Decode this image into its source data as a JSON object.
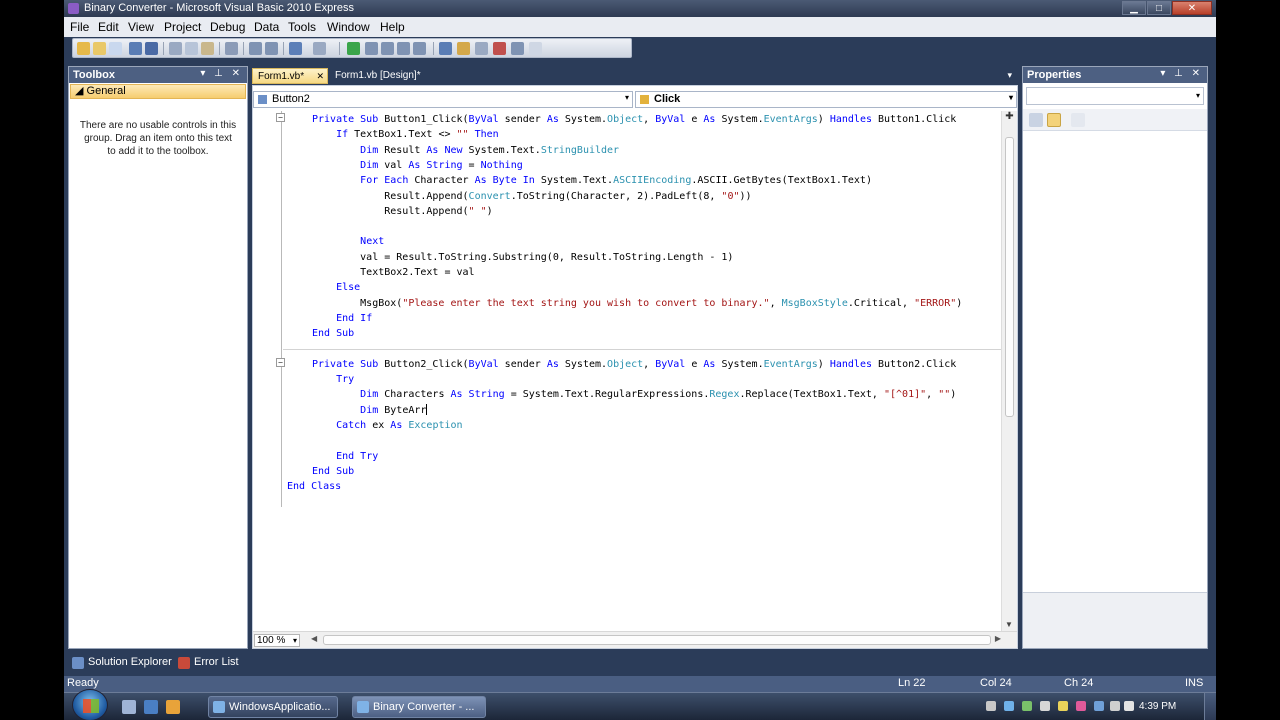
{
  "window": {
    "title": "Binary Converter - Microsoft Visual Basic 2010 Express"
  },
  "menu": [
    "File",
    "Edit",
    "View",
    "Project",
    "Debug",
    "Data",
    "Tools",
    "Window",
    "Help"
  ],
  "toolbox": {
    "title": "Toolbox",
    "group": "General",
    "empty_text": "There are no usable controls in this group. Drag an item onto this text to add it to the toolbox."
  },
  "doc_tabs": {
    "active": "Form1.vb*",
    "inactive": "Form1.vb [Design]*"
  },
  "editor": {
    "object_combo": "Button2",
    "event_combo": "Click",
    "zoom": "100 %"
  },
  "code_lines": [
    [
      [
        "kw",
        "Private Sub "
      ],
      [
        "",
        "Button1_Click("
      ],
      [
        "kw",
        "ByVal"
      ],
      [
        "",
        " sender "
      ],
      [
        "kw",
        "As"
      ],
      [
        "",
        " System."
      ],
      [
        "ty",
        "Object"
      ],
      [
        "",
        ", "
      ],
      [
        "kw",
        "ByVal"
      ],
      [
        "",
        " e "
      ],
      [
        "kw",
        "As"
      ],
      [
        "",
        " System."
      ],
      [
        "ty",
        "EventArgs"
      ],
      [
        "",
        ") "
      ],
      [
        "kw",
        "Handles"
      ],
      [
        "",
        " Button1.Click"
      ]
    ],
    [
      [
        "",
        "    "
      ],
      [
        "kw",
        "If"
      ],
      [
        "",
        " TextBox1.Text <> "
      ],
      [
        "st",
        "\"\""
      ],
      [
        "kw",
        " Then"
      ]
    ],
    [
      [
        "",
        "        "
      ],
      [
        "kw",
        "Dim"
      ],
      [
        "",
        " Result "
      ],
      [
        "kw",
        "As New"
      ],
      [
        "",
        " System.Text."
      ],
      [
        "ty",
        "StringBuilder"
      ]
    ],
    [
      [
        "",
        "        "
      ],
      [
        "kw",
        "Dim"
      ],
      [
        "",
        " val "
      ],
      [
        "kw",
        "As String"
      ],
      [
        "",
        " = "
      ],
      [
        "kw",
        "Nothing"
      ]
    ],
    [
      [
        "",
        "        "
      ],
      [
        "kw",
        "For Each"
      ],
      [
        "",
        " Character "
      ],
      [
        "kw",
        "As Byte In"
      ],
      [
        "",
        " System.Text."
      ],
      [
        "ty",
        "ASCIIEncoding"
      ],
      [
        "",
        ".ASCII.GetBytes(TextBox1.Text)"
      ]
    ],
    [
      [
        "",
        "            Result.Append("
      ],
      [
        "ty",
        "Convert"
      ],
      [
        "",
        ".ToString(Character, 2).PadLeft(8, "
      ],
      [
        "st",
        "\"0\""
      ],
      [
        "",
        "))"
      ]
    ],
    [
      [
        "",
        "            Result.Append("
      ],
      [
        "st",
        "\" \""
      ],
      [
        "",
        ")"
      ]
    ],
    [
      [
        "",
        ""
      ]
    ],
    [
      [
        "",
        "        "
      ],
      [
        "kw",
        "Next"
      ]
    ],
    [
      [
        "",
        "        val = Result.ToString.Substring(0, Result.ToString.Length - 1)"
      ]
    ],
    [
      [
        "",
        "        TextBox2.Text = val"
      ]
    ],
    [
      [
        "",
        "    "
      ],
      [
        "kw",
        "Else"
      ]
    ],
    [
      [
        "",
        "        MsgBox("
      ],
      [
        "st",
        "\"Please enter the text string you wish to convert to binary.\""
      ],
      [
        "",
        ", "
      ],
      [
        "ty",
        "MsgBoxStyle"
      ],
      [
        "",
        ".Critical, "
      ],
      [
        "st",
        "\"ERROR\""
      ],
      [
        "",
        ")"
      ]
    ],
    [
      [
        "",
        "    "
      ],
      [
        "kw",
        "End If"
      ]
    ],
    [
      [
        "kw",
        "End Sub"
      ]
    ],
    [
      [
        "",
        ""
      ]
    ],
    [
      [
        "kw",
        "Private Sub "
      ],
      [
        "",
        "Button2_Click("
      ],
      [
        "kw",
        "ByVal"
      ],
      [
        "",
        " sender "
      ],
      [
        "kw",
        "As"
      ],
      [
        "",
        " System."
      ],
      [
        "ty",
        "Object"
      ],
      [
        "",
        ", "
      ],
      [
        "kw",
        "ByVal"
      ],
      [
        "",
        " e "
      ],
      [
        "kw",
        "As"
      ],
      [
        "",
        " System."
      ],
      [
        "ty",
        "EventArgs"
      ],
      [
        "",
        ") "
      ],
      [
        "kw",
        "Handles"
      ],
      [
        "",
        " Button2.Click"
      ]
    ],
    [
      [
        "",
        "    "
      ],
      [
        "kw",
        "Try"
      ]
    ],
    [
      [
        "",
        "        "
      ],
      [
        "kw",
        "Dim"
      ],
      [
        "",
        " Characters "
      ],
      [
        "kw",
        "As String"
      ],
      [
        "",
        " = System.Text.RegularExpressions."
      ],
      [
        "ty",
        "Regex"
      ],
      [
        "",
        ".Replace(TextBox1.Text, "
      ],
      [
        "st",
        "\"[^01]\""
      ],
      [
        "",
        ", "
      ],
      [
        "st",
        "\"\""
      ],
      [
        "",
        ")"
      ]
    ],
    [
      [
        "",
        "        "
      ],
      [
        "kw",
        "Dim"
      ],
      [
        "",
        " ByteArr"
      ]
    ],
    [
      [
        "",
        "    "
      ],
      [
        "kw",
        "Catch"
      ],
      [
        "",
        " ex "
      ],
      [
        "kw",
        "As"
      ],
      [
        " ",
        " "
      ],
      [
        "ty",
        "Exception"
      ]
    ],
    [
      [
        "",
        ""
      ]
    ],
    [
      [
        "",
        "    "
      ],
      [
        "kw",
        "End Try"
      ]
    ],
    [
      [
        "kw",
        "End Sub"
      ]
    ],
    [
      [
        "kw",
        "End Class"
      ]
    ]
  ],
  "properties": {
    "title": "Properties"
  },
  "bottom_tabs": [
    "Solution Explorer",
    "Error List"
  ],
  "status": {
    "left": "Ready",
    "ln": "Ln 22",
    "col": "Col 24",
    "ch": "Ch 24",
    "mode": "INS"
  },
  "taskbar": {
    "tasks": [
      "WindowsApplicatio...",
      "Binary Converter - ..."
    ],
    "clock": "4:39 PM"
  }
}
